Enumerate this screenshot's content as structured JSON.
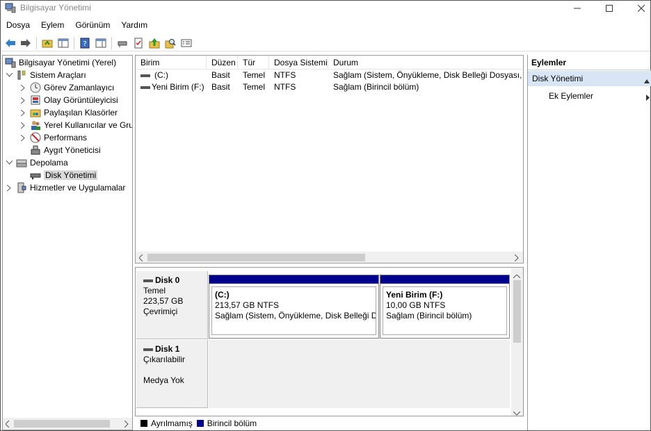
{
  "window": {
    "title": "Bilgisayar Yönetimi"
  },
  "menu": [
    "Dosya",
    "Eylem",
    "Görünüm",
    "Yardım"
  ],
  "tree": {
    "root": "Bilgisayar Yönetimi (Yerel)",
    "system_tools": "Sistem Araçları",
    "task_scheduler": "Görev Zamanlayıcı",
    "event_viewer": "Olay Görüntüleyicisi",
    "shared_folders": "Paylaşılan Klasörler",
    "local_users": "Yerel Kullanıcılar ve Gru",
    "performance": "Performans",
    "device_manager": "Aygıt Yöneticisi",
    "storage": "Depolama",
    "disk_management": "Disk Yönetimi",
    "services": "Hizmetler ve Uygulamalar"
  },
  "volume_list": {
    "headers": [
      "Birim",
      "Düzen",
      "Tür",
      "Dosya Sistemi",
      "Durum"
    ],
    "rows": [
      [
        "(C:)",
        "Basit",
        "Temel",
        "NTFS",
        "Sağlam (Sistem, Önyükleme, Disk Belleği Dosyası, Et"
      ],
      [
        "Yeni Birim (F:)",
        "Basit",
        "Temel",
        "NTFS",
        "Sağlam (Birincil bölüm)"
      ]
    ]
  },
  "disks": {
    "disk0": {
      "name": "Disk 0",
      "type": "Temel",
      "size": "223,57 GB",
      "status": "Çevrimiçi",
      "partitions": [
        {
          "name": "(C:)",
          "size": "213,57 GB NTFS",
          "status": "Sağlam (Sistem, Önyükleme, Disk Belleği Dc"
        },
        {
          "name": "Yeni Birim  (F:)",
          "size": "10,00 GB NTFS",
          "status": "Sağlam (Birincil bölüm)"
        }
      ]
    },
    "disk1": {
      "name": "Disk 1",
      "type": "Çıkarılabilir",
      "media": "Medya Yok"
    }
  },
  "legend": {
    "unallocated": "Ayrılmamış",
    "primary": "Birincil bölüm",
    "unallocated_color": "#000000",
    "primary_color": "#00008b"
  },
  "actions": {
    "header": "Eylemler",
    "section": "Disk Yönetimi",
    "more": "Ek Eylemler"
  },
  "colors": {
    "selection": "#d7e5f5",
    "partition_bar": "#00008b"
  }
}
